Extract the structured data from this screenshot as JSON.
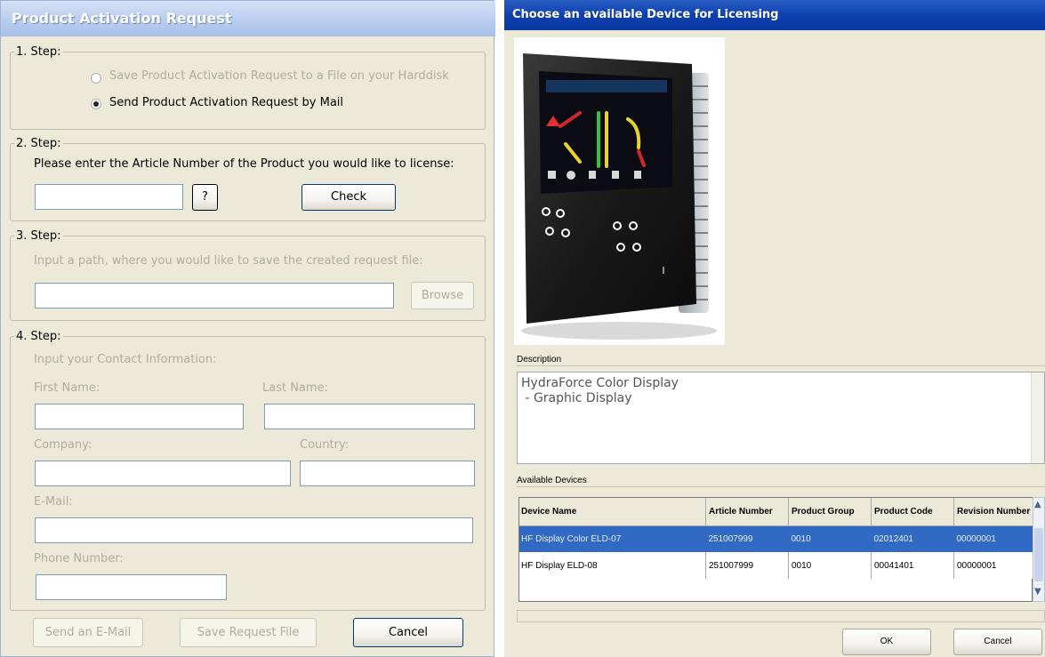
{
  "activation": {
    "title": "Product Activation Request",
    "step1": {
      "legend": "1. Step:",
      "option_file": "Save Product Activation Request to a File on your Harddisk",
      "option_mail": "Send Product Activation Request by Mail",
      "selected": "mail"
    },
    "step2": {
      "legend": "2. Step:",
      "instruction": "Please enter the Article Number of the Product you would like to license:",
      "article_value": "",
      "help_label": "?",
      "check_label": "Check"
    },
    "step3": {
      "legend": "3. Step:",
      "instruction": "Input a path, where you would like to save the created request file:",
      "path_value": "",
      "browse_label": "Browse"
    },
    "step4": {
      "legend": "4. Step:",
      "instruction": "Input your Contact Information:",
      "first_name_label": "First Name:",
      "last_name_label": "Last Name:",
      "company_label": "Company:",
      "country_label": "Country:",
      "email_label": "E-Mail:",
      "phone_label": "Phone Number:"
    },
    "buttons": {
      "send_email": "Send an E-Mail",
      "save_request": "Save Request File",
      "cancel": "Cancel"
    }
  },
  "device_chooser": {
    "title": "Choose an available Device for Licensing",
    "description_label": "Description",
    "description_lines": [
      "HydraForce Color Display",
      " - Graphic Display"
    ],
    "available_label": "Available Devices",
    "columns": [
      "Device Name",
      "Article Number",
      "Product Group",
      "Product Code",
      "Revision Number"
    ],
    "rows": [
      [
        "HF Display Color ELD-07",
        "251007999",
        "0010",
        "02012401",
        "00000001"
      ],
      [
        "HF Display ELD-08",
        "251007999",
        "0010",
        "00041401",
        "00000001"
      ]
    ],
    "selected_row": 0,
    "ok_label": "OK",
    "cancel_label": "Cancel"
  },
  "colors": {
    "dialog_bg": "#ece9d8",
    "left_title_gradient": "#b9cdef",
    "right_title_gradient": "#0d3fae",
    "selection": "#316ac5"
  }
}
